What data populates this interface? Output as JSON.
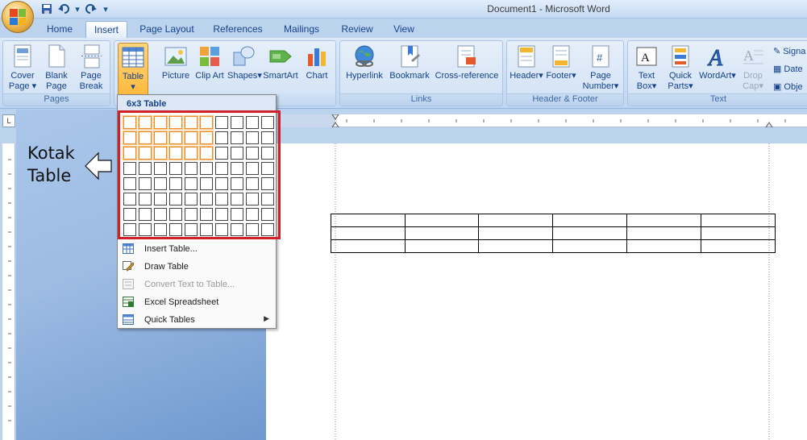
{
  "window": {
    "title": "Document1 - Microsoft Word"
  },
  "tabs": [
    "Home",
    "Insert",
    "Page Layout",
    "References",
    "Mailings",
    "Review",
    "View"
  ],
  "active_tab": "Insert",
  "ribbon": {
    "pages": {
      "label": "Pages",
      "cover_page": "Cover Page",
      "blank_page": "Blank Page",
      "page_break": "Page Break"
    },
    "tables": {
      "table": "Table"
    },
    "illustrations": {
      "picture": "Picture",
      "clip_art": "Clip Art",
      "shapes": "Shapes",
      "smartart": "SmartArt",
      "chart": "Chart"
    },
    "links": {
      "label": "Links",
      "hyperlink": "Hyperlink",
      "bookmark": "Bookmark",
      "cross_reference": "Cross-reference"
    },
    "header_footer": {
      "label": "Header & Footer",
      "header": "Header",
      "footer": "Footer",
      "page_number": "Page Number"
    },
    "text": {
      "label": "Text",
      "text_box": "Text Box",
      "quick_parts": "Quick Parts",
      "wordart": "WordArt",
      "drop_cap": "Drop Cap",
      "signature": "Signa",
      "date": "Date",
      "object": "Obje"
    }
  },
  "dropdown": {
    "header": "6x3 Table",
    "grid": {
      "cols": 10,
      "rows": 8,
      "selected_cols": 6,
      "selected_rows": 3
    },
    "items": [
      {
        "label": "Insert Table...",
        "enabled": true
      },
      {
        "label": "Draw Table",
        "enabled": true
      },
      {
        "label": "Convert Text to Table...",
        "enabled": false
      },
      {
        "label": "Excel Spreadsheet",
        "enabled": true
      },
      {
        "label": "Quick Tables",
        "enabled": true
      }
    ]
  },
  "annotation": {
    "line1": "Kotak",
    "line2": "Table"
  },
  "document": {
    "table": {
      "cols": 6,
      "rows": 3
    }
  },
  "colors": {
    "highlight_orange": "#f08a24",
    "callout_red": "#d0202a",
    "ribbon_blue": "#c9dcf4"
  }
}
